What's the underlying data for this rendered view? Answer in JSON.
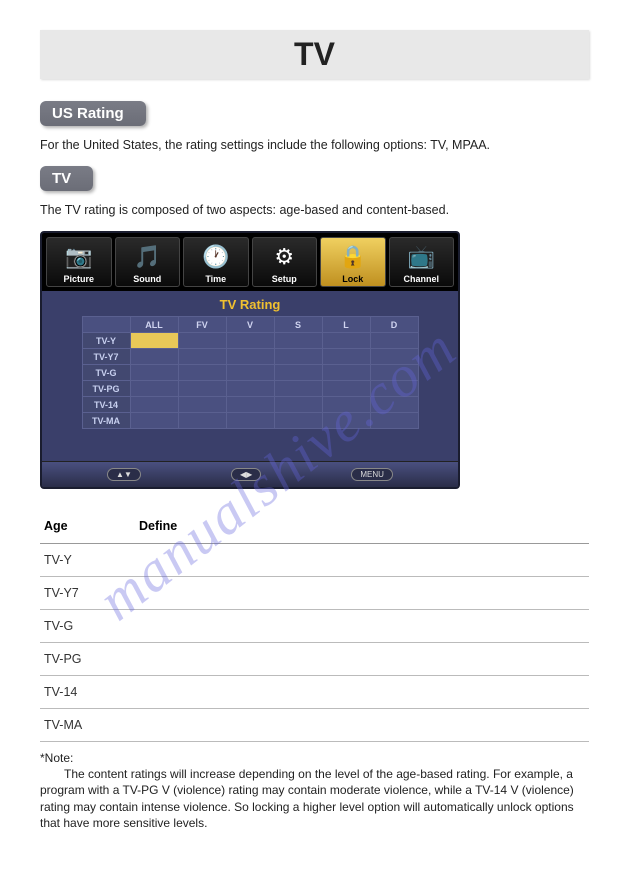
{
  "header": {
    "title": "TV"
  },
  "sections": {
    "us_rating": {
      "label": "US Rating",
      "intro": "For the United States, the rating settings include the following options:  TV, MPAA."
    },
    "tv": {
      "label": "TV",
      "intro": "The TV rating is composed of two aspects: age-based and content-based."
    }
  },
  "osd": {
    "tabs": [
      {
        "label": "Picture",
        "icon": "📷"
      },
      {
        "label": "Sound",
        "icon": "🎵"
      },
      {
        "label": "Time",
        "icon": "🕐"
      },
      {
        "label": "Setup",
        "icon": "⚙"
      },
      {
        "label": "Lock",
        "icon": "🔒",
        "active": true
      },
      {
        "label": "Channel",
        "icon": "📺"
      }
    ],
    "title": "TV Rating",
    "columns": [
      "",
      "ALL",
      "FV",
      "V",
      "S",
      "L",
      "D"
    ],
    "rows": [
      "TV-Y",
      "TV-Y7",
      "TV-G",
      "TV-PG",
      "TV-14",
      "TV-MA"
    ],
    "footer": {
      "left": "▲▼",
      "center": "◀▶",
      "right": "MENU"
    }
  },
  "age_table": {
    "headers": [
      "Age",
      "Define"
    ],
    "rows": [
      "TV-Y",
      "TV-Y7",
      "TV-G",
      "TV-PG",
      "TV-14",
      "TV-MA"
    ]
  },
  "note": {
    "label": "*Note:",
    "body": "The content ratings will increase depending on the level of the age-based rating. For example, a program with a TV-PG V (violence) rating may contain moderate violence, while a TV-14 V (violence) rating may contain intense violence. So locking a higher level option will automatically unlock options that have more sensitive levels."
  },
  "watermark": "manualshive.com"
}
